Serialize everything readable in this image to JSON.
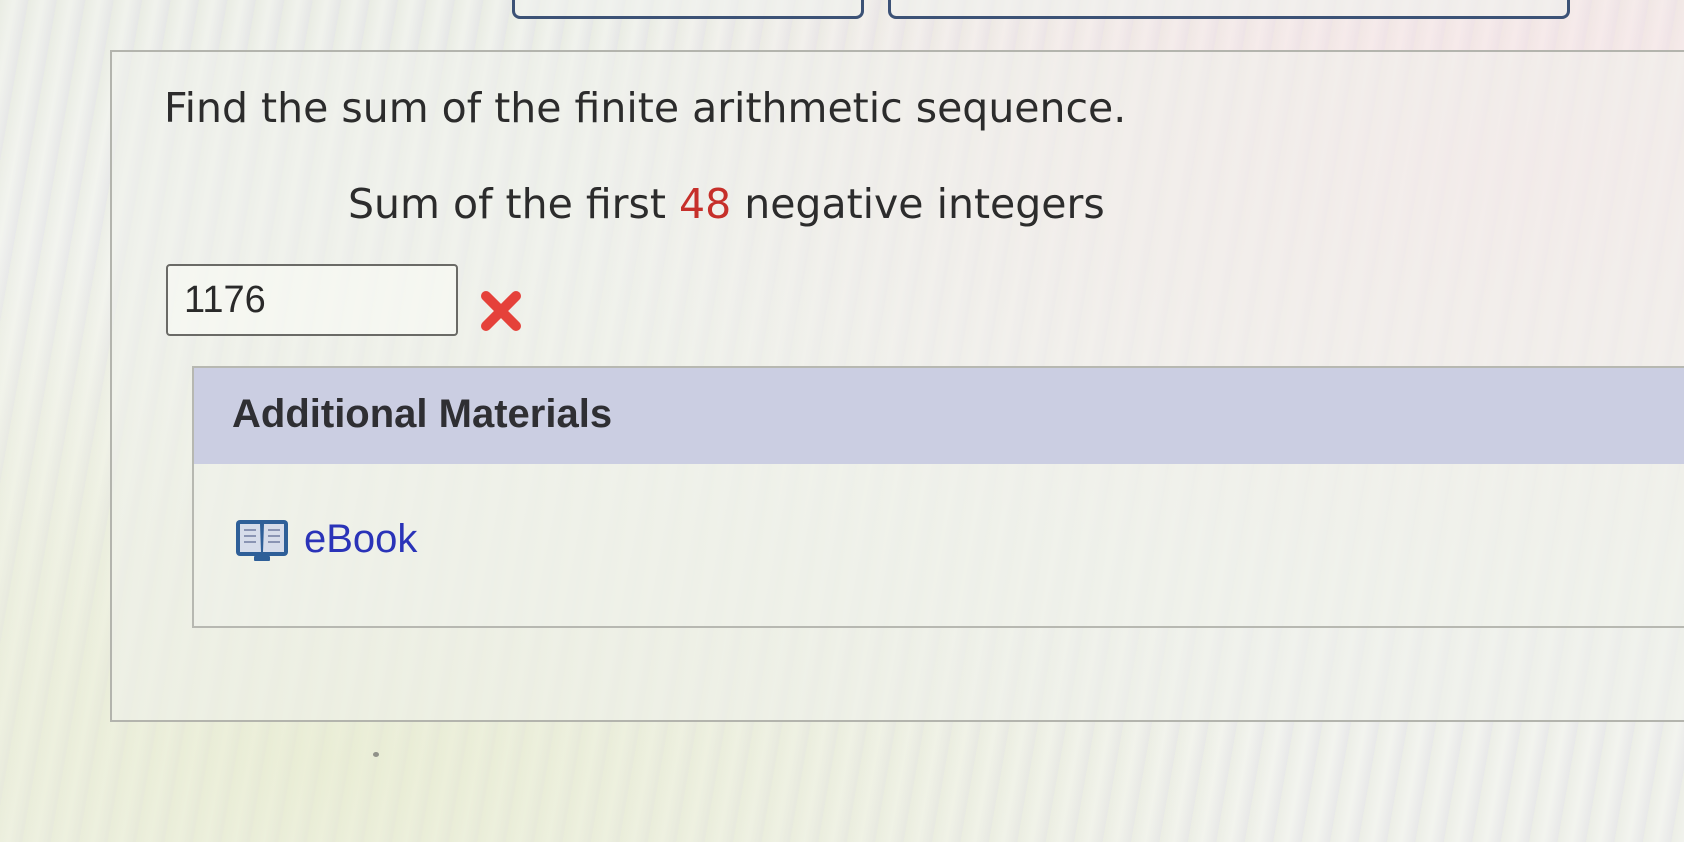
{
  "question": {
    "instruction": "Find the sum of the finite arithmetic sequence.",
    "prompt_before": "Sum of the first ",
    "prompt_number": "48",
    "prompt_after": " negative integers"
  },
  "answer": {
    "value": "1176",
    "status_icon": "x-mark-icon",
    "status": "incorrect"
  },
  "additional_materials": {
    "title": "Additional Materials",
    "links": [
      {
        "label": "eBook",
        "icon": "book-icon"
      }
    ]
  },
  "colors": {
    "incorrect": "#e5413a",
    "highlight_number": "#c62f2a",
    "link": "#2a33b8",
    "materials_header": "#c4c8e0",
    "tab_border": "#3c5276"
  }
}
